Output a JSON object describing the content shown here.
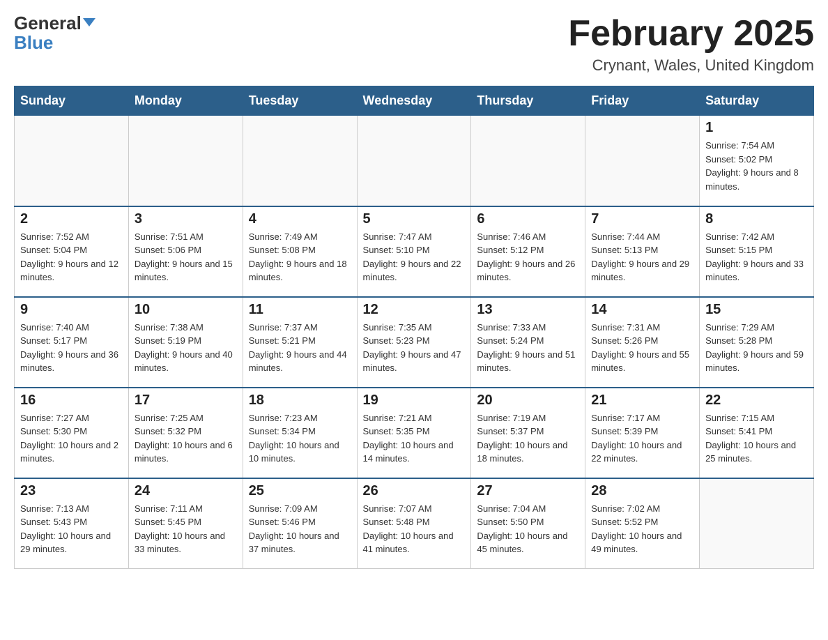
{
  "header": {
    "logo_general": "General",
    "logo_blue": "Blue",
    "month_title": "February 2025",
    "location": "Crynant, Wales, United Kingdom"
  },
  "days_of_week": [
    "Sunday",
    "Monday",
    "Tuesday",
    "Wednesday",
    "Thursday",
    "Friday",
    "Saturday"
  ],
  "weeks": [
    [
      {
        "day": "",
        "info": ""
      },
      {
        "day": "",
        "info": ""
      },
      {
        "day": "",
        "info": ""
      },
      {
        "day": "",
        "info": ""
      },
      {
        "day": "",
        "info": ""
      },
      {
        "day": "",
        "info": ""
      },
      {
        "day": "1",
        "info": "Sunrise: 7:54 AM\nSunset: 5:02 PM\nDaylight: 9 hours and 8 minutes."
      }
    ],
    [
      {
        "day": "2",
        "info": "Sunrise: 7:52 AM\nSunset: 5:04 PM\nDaylight: 9 hours and 12 minutes."
      },
      {
        "day": "3",
        "info": "Sunrise: 7:51 AM\nSunset: 5:06 PM\nDaylight: 9 hours and 15 minutes."
      },
      {
        "day": "4",
        "info": "Sunrise: 7:49 AM\nSunset: 5:08 PM\nDaylight: 9 hours and 18 minutes."
      },
      {
        "day": "5",
        "info": "Sunrise: 7:47 AM\nSunset: 5:10 PM\nDaylight: 9 hours and 22 minutes."
      },
      {
        "day": "6",
        "info": "Sunrise: 7:46 AM\nSunset: 5:12 PM\nDaylight: 9 hours and 26 minutes."
      },
      {
        "day": "7",
        "info": "Sunrise: 7:44 AM\nSunset: 5:13 PM\nDaylight: 9 hours and 29 minutes."
      },
      {
        "day": "8",
        "info": "Sunrise: 7:42 AM\nSunset: 5:15 PM\nDaylight: 9 hours and 33 minutes."
      }
    ],
    [
      {
        "day": "9",
        "info": "Sunrise: 7:40 AM\nSunset: 5:17 PM\nDaylight: 9 hours and 36 minutes."
      },
      {
        "day": "10",
        "info": "Sunrise: 7:38 AM\nSunset: 5:19 PM\nDaylight: 9 hours and 40 minutes."
      },
      {
        "day": "11",
        "info": "Sunrise: 7:37 AM\nSunset: 5:21 PM\nDaylight: 9 hours and 44 minutes."
      },
      {
        "day": "12",
        "info": "Sunrise: 7:35 AM\nSunset: 5:23 PM\nDaylight: 9 hours and 47 minutes."
      },
      {
        "day": "13",
        "info": "Sunrise: 7:33 AM\nSunset: 5:24 PM\nDaylight: 9 hours and 51 minutes."
      },
      {
        "day": "14",
        "info": "Sunrise: 7:31 AM\nSunset: 5:26 PM\nDaylight: 9 hours and 55 minutes."
      },
      {
        "day": "15",
        "info": "Sunrise: 7:29 AM\nSunset: 5:28 PM\nDaylight: 9 hours and 59 minutes."
      }
    ],
    [
      {
        "day": "16",
        "info": "Sunrise: 7:27 AM\nSunset: 5:30 PM\nDaylight: 10 hours and 2 minutes."
      },
      {
        "day": "17",
        "info": "Sunrise: 7:25 AM\nSunset: 5:32 PM\nDaylight: 10 hours and 6 minutes."
      },
      {
        "day": "18",
        "info": "Sunrise: 7:23 AM\nSunset: 5:34 PM\nDaylight: 10 hours and 10 minutes."
      },
      {
        "day": "19",
        "info": "Sunrise: 7:21 AM\nSunset: 5:35 PM\nDaylight: 10 hours and 14 minutes."
      },
      {
        "day": "20",
        "info": "Sunrise: 7:19 AM\nSunset: 5:37 PM\nDaylight: 10 hours and 18 minutes."
      },
      {
        "day": "21",
        "info": "Sunrise: 7:17 AM\nSunset: 5:39 PM\nDaylight: 10 hours and 22 minutes."
      },
      {
        "day": "22",
        "info": "Sunrise: 7:15 AM\nSunset: 5:41 PM\nDaylight: 10 hours and 25 minutes."
      }
    ],
    [
      {
        "day": "23",
        "info": "Sunrise: 7:13 AM\nSunset: 5:43 PM\nDaylight: 10 hours and 29 minutes."
      },
      {
        "day": "24",
        "info": "Sunrise: 7:11 AM\nSunset: 5:45 PM\nDaylight: 10 hours and 33 minutes."
      },
      {
        "day": "25",
        "info": "Sunrise: 7:09 AM\nSunset: 5:46 PM\nDaylight: 10 hours and 37 minutes."
      },
      {
        "day": "26",
        "info": "Sunrise: 7:07 AM\nSunset: 5:48 PM\nDaylight: 10 hours and 41 minutes."
      },
      {
        "day": "27",
        "info": "Sunrise: 7:04 AM\nSunset: 5:50 PM\nDaylight: 10 hours and 45 minutes."
      },
      {
        "day": "28",
        "info": "Sunrise: 7:02 AM\nSunset: 5:52 PM\nDaylight: 10 hours and 49 minutes."
      },
      {
        "day": "",
        "info": ""
      }
    ]
  ]
}
